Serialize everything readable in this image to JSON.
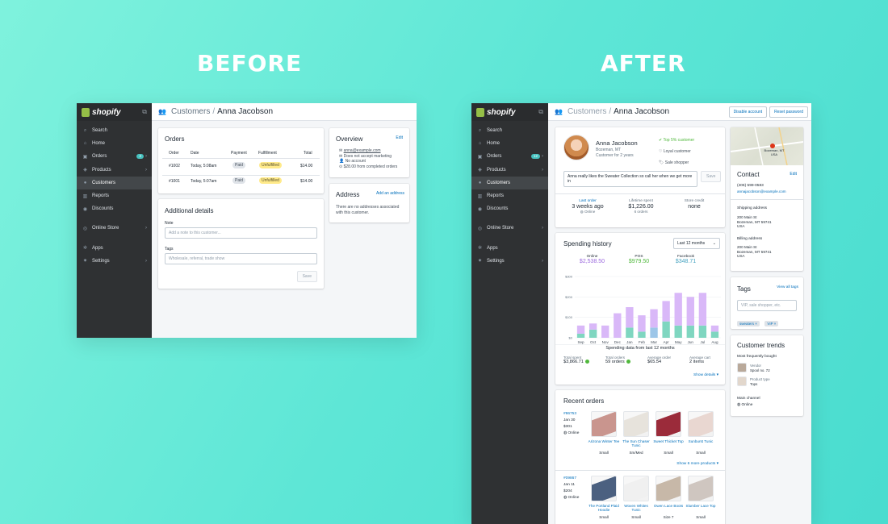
{
  "headings": {
    "before": "BEFORE",
    "after": "AFTER"
  },
  "shop": {
    "logo_text": "shopify"
  },
  "nav": [
    {
      "icon": "search-icon",
      "glyph": "⌕",
      "label": "Search"
    },
    {
      "icon": "home-icon",
      "glyph": "⌂",
      "label": "Home"
    },
    {
      "icon": "orders-icon",
      "glyph": "▣",
      "label": "Orders",
      "badge": "2"
    },
    {
      "icon": "tag-icon",
      "glyph": "◈",
      "label": "Products"
    },
    {
      "icon": "customers-icon",
      "glyph": "●",
      "label": "Customers"
    },
    {
      "icon": "reports-icon",
      "glyph": "▥",
      "label": "Reports"
    },
    {
      "icon": "discounts-icon",
      "glyph": "◉",
      "label": "Discounts"
    },
    {
      "icon": "store-icon",
      "glyph": "◎",
      "label": "Online Store"
    },
    {
      "icon": "apps-icon",
      "glyph": "✲",
      "label": "Apps"
    },
    {
      "icon": "gear-icon",
      "glyph": "✷",
      "label": "Settings"
    }
  ],
  "after_nav_badge": "12",
  "breadcrumb": {
    "parent": "Customers",
    "sep": "/",
    "current": "Anna Jacobson"
  },
  "before": {
    "orders": {
      "title": "Orders",
      "columns": [
        "Order",
        "Date",
        "Payment",
        "Fulfillment",
        "Total"
      ],
      "rows": [
        {
          "order": "#1002",
          "date": "Today, 5:08am",
          "payment": "Paid",
          "fulfillment": "Unfulfilled",
          "total": "$14.00"
        },
        {
          "order": "#1001",
          "date": "Today, 5:07am",
          "payment": "Paid",
          "fulfillment": "Unfulfilled",
          "total": "$14.00"
        }
      ]
    },
    "details": {
      "title": "Additional details",
      "note_label": "Note",
      "note_placeholder": "Add a note to this customer...",
      "tags_label": "Tags",
      "tags_placeholder": "Wholesale, referral, trade show",
      "save": "Save"
    },
    "overview": {
      "title": "Overview",
      "edit": "Edit",
      "email": "anna@example.com",
      "marketing": "Does not accept marketing",
      "account": "No account",
      "completed": "$28.00 from completed orders"
    },
    "address": {
      "title": "Address",
      "add": "Add an address",
      "empty": "There are no addresses associated with this customer."
    }
  },
  "after": {
    "top_buttons": [
      "Disable account",
      "Reset password"
    ],
    "profile": {
      "name": "Anna Jacobson",
      "location": "Bozeman, MT",
      "since": "Customer for 2 years",
      "badges": [
        "Top 5% customer",
        "Loyal customer",
        "Sale shopper"
      ],
      "note": "Anna really likes the Sweater Collection so call her when we get more in",
      "save": "Save",
      "stats": [
        {
          "label": "Last order",
          "value": "3 weeks ago",
          "sub": "Online"
        },
        {
          "label": "Lifetime spent",
          "value": "$1,226.00",
          "sub": "6 orders"
        },
        {
          "label": "Store credit",
          "value": "none",
          "sub": ""
        }
      ]
    },
    "spending": {
      "title": "Spending history",
      "range": "Last 12 months",
      "channels": [
        {
          "label": "Online",
          "value": "$2,538.50",
          "color": "#9c6ade"
        },
        {
          "label": "POS",
          "value": "$979.50",
          "color": "#50b83c"
        },
        {
          "label": "Facebook",
          "value": "$348.71",
          "color": "#47a3c1"
        }
      ],
      "summary_title": "Spending data from last 12 months",
      "summary": [
        {
          "label": "Total spent",
          "value": "$3,866.71",
          "ok": true
        },
        {
          "label": "Total orders",
          "value": "59 orders",
          "ok": true
        },
        {
          "label": "Average order",
          "value": "$65.54",
          "ok": false
        },
        {
          "label": "Average cart",
          "value": "2 items",
          "ok": false
        }
      ],
      "show_details": "Show details ▾"
    },
    "chart_data": {
      "type": "bar",
      "categories": [
        "Sep",
        "Oct",
        "Nov",
        "Dec",
        "Jan",
        "Feb",
        "Mar",
        "Apr",
        "May",
        "Jun",
        "Jul",
        "Aug"
      ],
      "series": [
        {
          "name": "Online",
          "values": [
            40,
            30,
            60,
            120,
            100,
            80,
            90,
            100,
            160,
            140,
            160,
            30
          ]
        },
        {
          "name": "POS",
          "values": [
            20,
            40,
            0,
            0,
            50,
            30,
            0,
            80,
            60,
            60,
            60,
            30
          ]
        },
        {
          "name": "Facebook",
          "values": [
            0,
            0,
            0,
            0,
            0,
            0,
            50,
            0,
            0,
            0,
            0,
            0
          ]
        }
      ],
      "y_ticks": [
        "$300",
        "$200",
        "$100",
        "$0"
      ],
      "ylim": [
        0,
        300
      ]
    },
    "recent": {
      "title": "Recent orders",
      "show_more": "Show 6 more products ▾",
      "orders": [
        {
          "id": "#86753",
          "date": "Jan 30",
          "total": "$301",
          "channel": "Online",
          "items": [
            {
              "name": "Arizona Winter Tee",
              "size": "Small",
              "color": "#c9958e"
            },
            {
              "name": "The Sun Chaser Tunic",
              "size": "Sm/Med",
              "color": "#e7e3dc"
            },
            {
              "name": "Sweet Thicket Top",
              "size": "Small",
              "color": "#9b2b3a"
            },
            {
              "name": "Sunburst Tunic",
              "size": "Small",
              "color": "#e9d7d1"
            }
          ]
        },
        {
          "id": "#09867",
          "date": "Jan 11",
          "total": "$204",
          "channel": "Online",
          "items": [
            {
              "name": "The Portland Plaid Hoodie",
              "size": "Small",
              "color": "#4b6080"
            },
            {
              "name": "Woven Whites Tunic",
              "size": "Small",
              "color": "#f0f0f0"
            },
            {
              "name": "Owen Lace Boots",
              "size": "Size 7",
              "color": "#c7b8a8"
            },
            {
              "name": "Slumber Lace Top",
              "size": "Small",
              "color": "#cfc6c0"
            }
          ]
        }
      ]
    },
    "map_label": "Bozeman, MT USA",
    "contact": {
      "title": "Contact",
      "edit": "Edit",
      "phone": "(406) 599-0583",
      "email": "annajacobson@example.com",
      "shipping_label": "Shipping address",
      "shipping": [
        "200 Main St",
        "Bozeman, MT 59741",
        "USA"
      ],
      "billing_label": "Billing address",
      "billing": [
        "200 Main St",
        "Bozeman, MT 59741",
        "USA"
      ]
    },
    "tags": {
      "title": "Tags",
      "view_all": "View all tags",
      "placeholder": "VIP, sale shopper, etc.",
      "items": [
        "sweaters ×",
        "VIP ×"
      ]
    },
    "trends": {
      "title": "Customer trends",
      "most_label": "Most frequently bought",
      "vendor_label": "Vendor",
      "vendor": "Spool no. 72",
      "type_label": "Product type",
      "type": "Tops",
      "channel_label": "Main channel",
      "channel": "Online"
    }
  }
}
